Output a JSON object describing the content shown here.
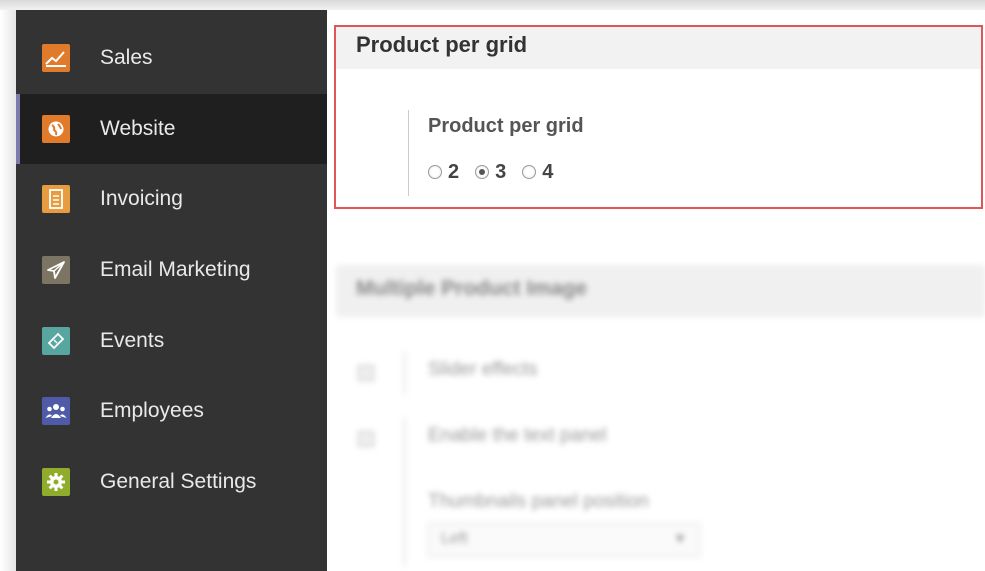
{
  "sidebar": {
    "items": [
      {
        "label": "Sales",
        "icon": "sales-chart-icon",
        "color": "#e07b2b",
        "glyph": "📈"
      },
      {
        "label": "Website",
        "icon": "globe-icon",
        "color": "#e07b2b",
        "glyph": "◕"
      },
      {
        "label": "Invoicing",
        "icon": "invoice-document-icon",
        "color": "#e69c3f",
        "glyph": "▤"
      },
      {
        "label": "Email Marketing",
        "icon": "paper-plane-icon",
        "color": "#7d7563",
        "glyph": "➤"
      },
      {
        "label": "Events",
        "icon": "ticket-icon",
        "color": "#58a6a0",
        "glyph": "◈"
      },
      {
        "label": "Employees",
        "icon": "people-icon",
        "color": "#4f5ba8",
        "glyph": "👥"
      },
      {
        "label": "General Settings",
        "icon": "gear-icon",
        "color": "#8fad2a",
        "glyph": "⚙"
      }
    ],
    "active_index": 1
  },
  "product_grid": {
    "section_title": "Product per grid",
    "field_label": "Product per grid",
    "options": [
      "2",
      "3",
      "4"
    ],
    "selected": "3"
  },
  "blurred": {
    "section_title": "Multiple Product Image",
    "slider_effects": "Slider effects",
    "text_panel": "Enable the text panel",
    "thumb_position_label": "Thumbnails panel position",
    "thumb_position_value": "Left"
  },
  "colors": {
    "highlight": "#e05555",
    "sidebar_bg": "#333333",
    "active_bg": "#1f1f1f",
    "active_marker": "#7c7bad"
  }
}
